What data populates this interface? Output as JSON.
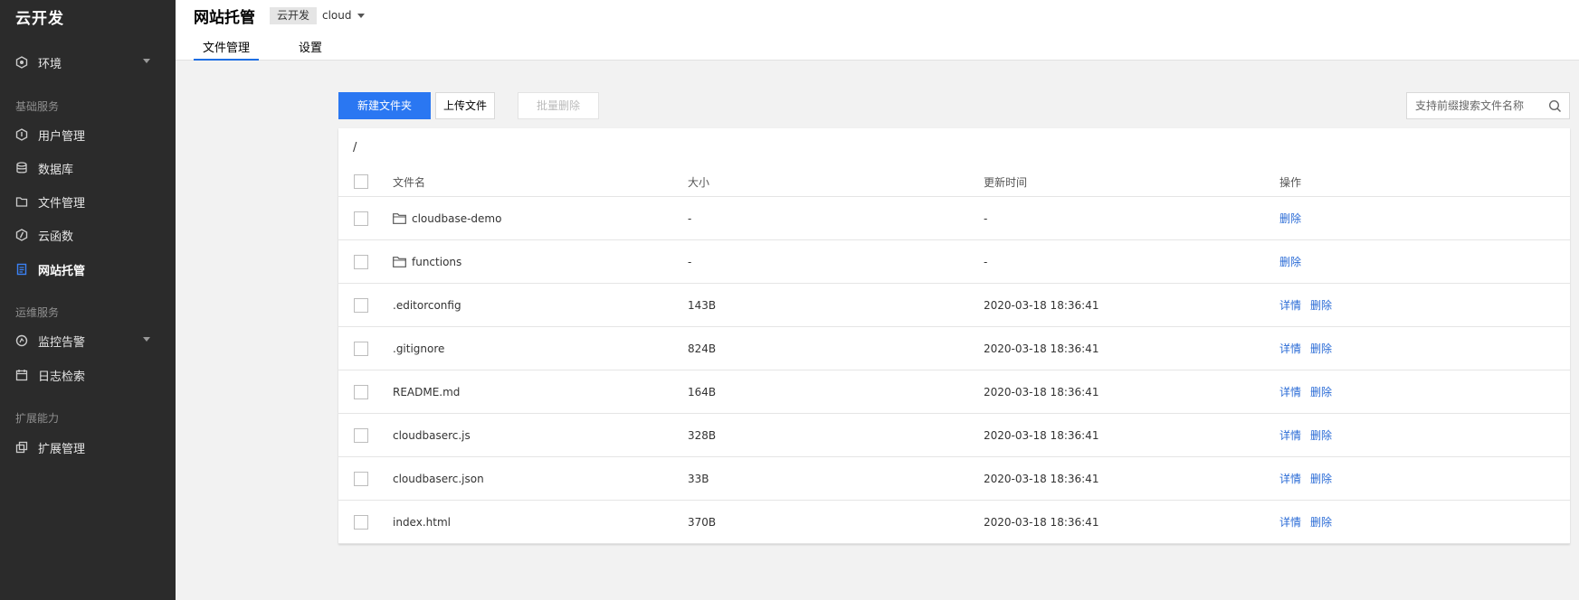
{
  "sidebar": {
    "brand": "云开发",
    "env": {
      "label": "环境",
      "icon": "hexagon-icon"
    },
    "groups": [
      {
        "title": "基础服务"
      },
      {
        "title": "运维服务"
      },
      {
        "title": "扩展能力"
      }
    ],
    "items": [
      {
        "label": "用户管理",
        "icon": "shield-icon"
      },
      {
        "label": "数据库",
        "icon": "database-icon"
      },
      {
        "label": "文件管理",
        "icon": "folder-icon"
      },
      {
        "label": "云函数",
        "icon": "function-icon"
      },
      {
        "label": "网站托管",
        "icon": "document-icon",
        "active": true
      },
      {
        "label": "监控告警",
        "icon": "monitor-icon"
      },
      {
        "label": "日志检索",
        "icon": "calendar-icon"
      },
      {
        "label": "扩展管理",
        "icon": "extension-icon"
      }
    ]
  },
  "header": {
    "title": "网站托管",
    "env_tag": "云开发",
    "env_name": "cloud",
    "tabs": [
      {
        "label": "文件管理",
        "active": true
      },
      {
        "label": "设置",
        "active": false
      }
    ]
  },
  "toolbar": {
    "new_folder": "新建文件夹",
    "upload": "上传文件",
    "batch_delete": "批量删除",
    "search_placeholder": "支持前缀搜索文件名称"
  },
  "table": {
    "path": "/",
    "columns": [
      "文件名",
      "大小",
      "更新时间",
      "操作"
    ],
    "rows": [
      {
        "name": "cloudbase-demo",
        "type": "folder",
        "size": "-",
        "time": "-",
        "actions": [
          "删除"
        ]
      },
      {
        "name": "functions",
        "type": "folder",
        "size": "-",
        "time": "-",
        "actions": [
          "删除"
        ]
      },
      {
        "name": ".editorconfig",
        "type": "file",
        "size": "143B",
        "time": "2020-03-18 18:36:41",
        "actions": [
          "详情",
          "删除"
        ]
      },
      {
        "name": ".gitignore",
        "type": "file",
        "size": "824B",
        "time": "2020-03-18 18:36:41",
        "actions": [
          "详情",
          "删除"
        ]
      },
      {
        "name": "README.md",
        "type": "file",
        "size": "164B",
        "time": "2020-03-18 18:36:41",
        "actions": [
          "详情",
          "删除"
        ]
      },
      {
        "name": "cloudbaserc.js",
        "type": "file",
        "size": "328B",
        "time": "2020-03-18 18:36:41",
        "actions": [
          "详情",
          "删除"
        ]
      },
      {
        "name": "cloudbaserc.json",
        "type": "file",
        "size": "33B",
        "time": "2020-03-18 18:36:41",
        "actions": [
          "详情",
          "删除"
        ]
      },
      {
        "name": "index.html",
        "type": "file",
        "size": "370B",
        "time": "2020-03-18 18:36:41",
        "actions": [
          "详情",
          "删除"
        ]
      }
    ]
  },
  "colors": {
    "accent": "#2a77f2",
    "link": "#2a6bd6",
    "sidebar_bg": "#2b2b2b"
  }
}
